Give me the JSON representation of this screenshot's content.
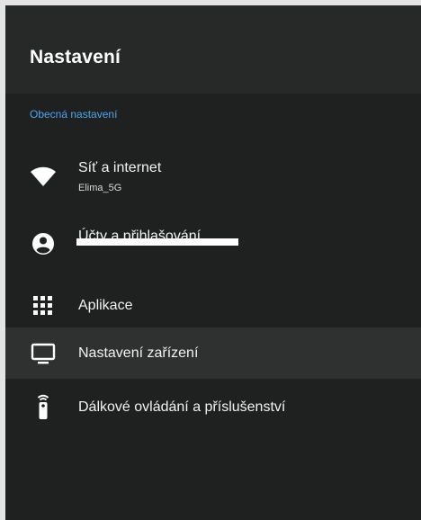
{
  "header": {
    "title": "Nastavení"
  },
  "section": {
    "label": "Obecná nastavení"
  },
  "menu": {
    "items": [
      {
        "label": "Síť a internet",
        "subtitle": "Elima_5G",
        "icon": "wifi-icon"
      },
      {
        "label": "Účty a přihlašování",
        "subtitle": "",
        "icon": "account-icon"
      },
      {
        "label": "Aplikace",
        "icon": "apps-grid-icon"
      },
      {
        "label": "Nastavení zařízení",
        "icon": "tv-icon",
        "selected": true
      },
      {
        "label": "Dálkové ovládání a příslušenství",
        "icon": "remote-icon"
      }
    ]
  },
  "colors": {
    "background": "#1f2020",
    "header": "#272828",
    "accent": "#4ea4ee",
    "selected_row": "#2f3030",
    "text": "#f2f2f2"
  }
}
